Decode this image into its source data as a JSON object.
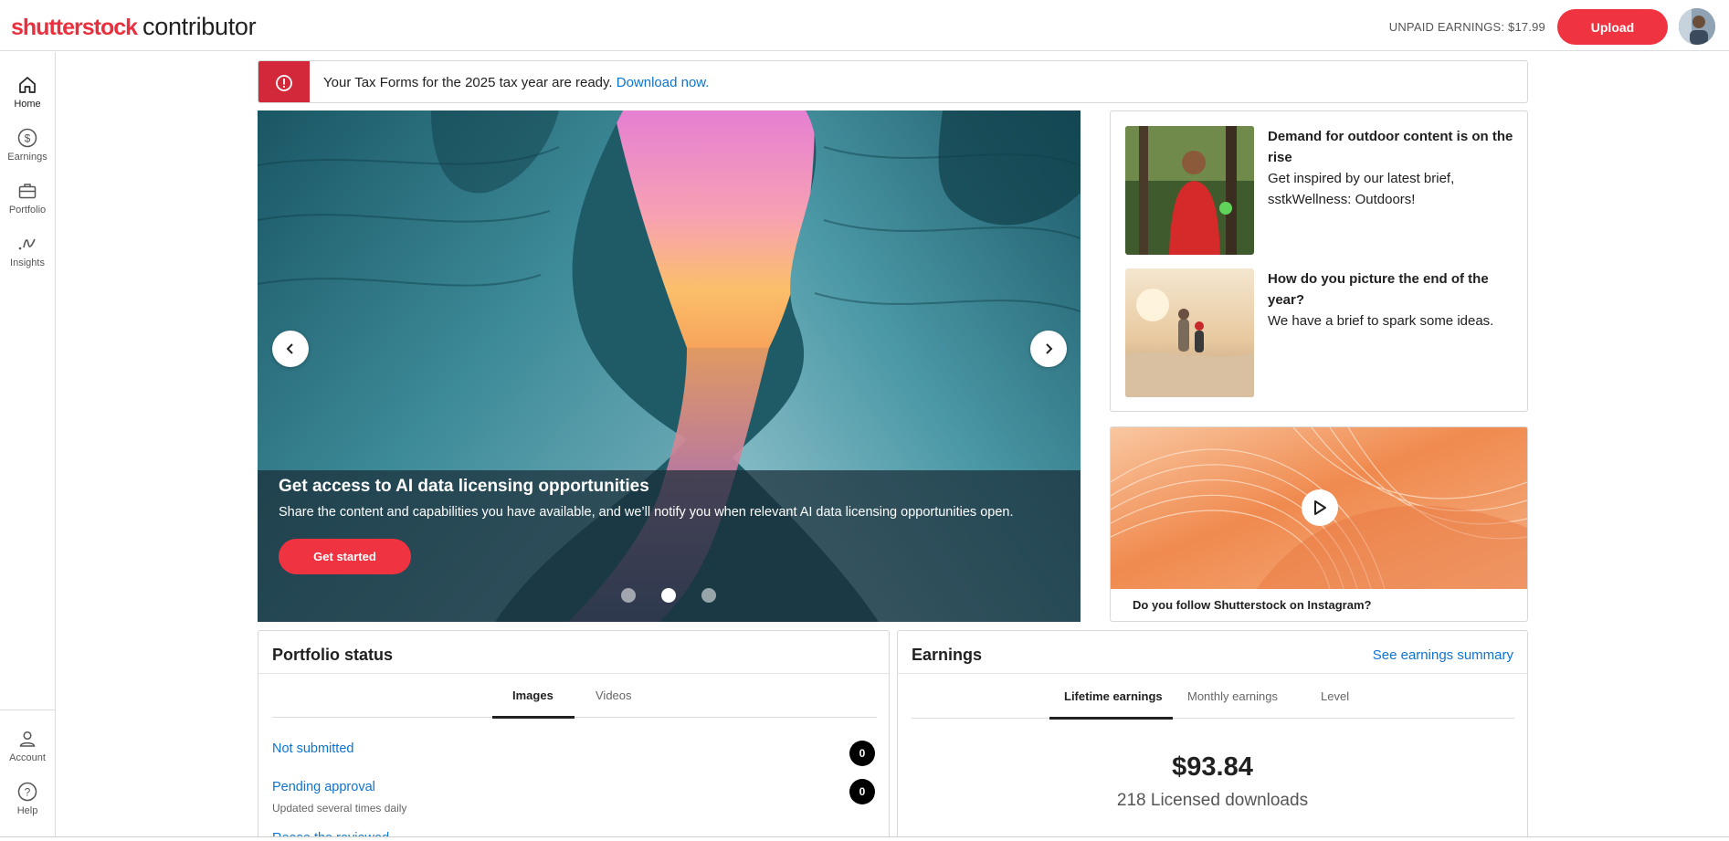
{
  "header": {
    "logo_brand": "shutterstock",
    "logo_sub": "contributor",
    "unpaid_earnings": "UNPAID EARNINGS: $17.99",
    "upload_label": "Upload",
    "avatar_icon": "user-avatar"
  },
  "sidebar": {
    "items": [
      {
        "label": "Home",
        "icon": "home-icon",
        "active": true
      },
      {
        "label": "Earnings",
        "icon": "dollar-circle-icon"
      },
      {
        "label": "Portfolio",
        "icon": "briefcase-icon"
      },
      {
        "label": "Insights",
        "icon": "insights-icon"
      }
    ],
    "bottom_items": [
      {
        "label": "Account",
        "icon": "user-icon"
      },
      {
        "label": "Help",
        "icon": "help-icon"
      }
    ]
  },
  "banner": {
    "text": "Your Tax Forms for the 2025 tax year are ready. ",
    "link": "Download now.",
    "icon": "alert-icon",
    "accent_color": "#d3283a"
  },
  "hero": {
    "title": "Get access to AI data licensing opportunities",
    "description": "Share the content and capabilities you have available, and we’ll notify you when relevant AI data licensing opportunities open.",
    "button_label": "Get started",
    "slide_count": 3,
    "active_slide": 2
  },
  "briefs": [
    {
      "title": "Demand for outdoor content is on the rise",
      "body": "Get inspired by our latest brief, sstkWellness: Outdoors!"
    },
    {
      "title": "How do you picture the end of the year?",
      "body": "We have a brief to spark some ideas."
    }
  ],
  "instagram": {
    "caption": "Do you follow Shutterstock on Instagram?"
  },
  "portfolio": {
    "title": "Portfolio status",
    "tabs": [
      "Images",
      "Videos"
    ],
    "active_tab": "Images",
    "rows": [
      {
        "label": "Not submitted",
        "count": "0",
        "sub": ""
      },
      {
        "label": "Pending approval",
        "count": "0",
        "sub": "Updated several times daily"
      },
      {
        "label": "Reese the reviewed",
        "count": "",
        "sub": ""
      }
    ]
  },
  "earnings": {
    "title": "Earnings",
    "summary_link": "See earnings summary",
    "tabs": [
      "Lifetime earnings",
      "Monthly earnings",
      "Level"
    ],
    "active_tab": "Lifetime earnings",
    "amount": "$93.84",
    "downloads": "218 Licensed downloads"
  },
  "colors": {
    "brand_red": "#ef3340",
    "link_blue": "#0d74d1"
  }
}
